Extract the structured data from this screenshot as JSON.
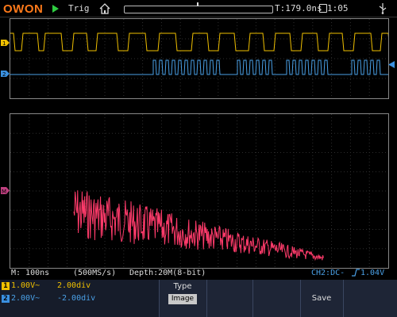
{
  "topbar": {
    "brand": "OWON",
    "trigger_status": "Trig",
    "time_offset": "T:179.0ns",
    "clock": "1:05"
  },
  "channels": {
    "ch1": {
      "badge": "1",
      "volts": "1.00V~",
      "position": "2.00div",
      "color": "#f0c000"
    },
    "ch2": {
      "badge": "2",
      "volts": "2.00V~",
      "position": "-2.00div",
      "color": "#4aa0e6"
    }
  },
  "info": {
    "timebase": "M: 100ns",
    "sample_rate": "(500MS/s)",
    "depth": "Depth:20M(8-bit)",
    "trigger_source": "CH2:DC-",
    "trigger_level": "1.04V"
  },
  "menu": {
    "type_label": "Type",
    "type_value": "Image",
    "save_label": "Save"
  },
  "colors": {
    "fft": "#ff3b6b",
    "grid": "#2e2e2e",
    "menu_bg": "#1e2536"
  },
  "icons": [
    "play-icon",
    "home-icon",
    "clock-icon",
    "usb-icon",
    "ch1-marker-icon",
    "ch2-marker-icon",
    "math-marker-icon",
    "trigger-level-icon",
    "rising-edge-icon"
  ]
}
